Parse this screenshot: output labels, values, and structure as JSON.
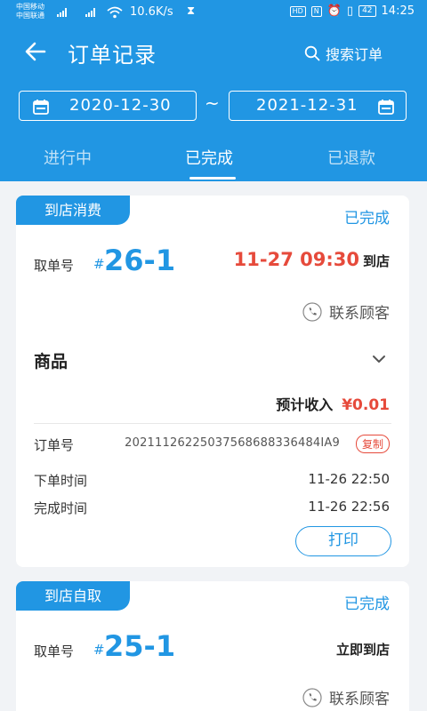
{
  "status_bar": {
    "carrier1": "中国移动",
    "carrier2": "中国联通",
    "net_speed": "10.6K/s",
    "hd": "HD",
    "nfc": "N",
    "battery": "42",
    "time": "14:25"
  },
  "header": {
    "title": "订单记录",
    "search_label": "搜索订单"
  },
  "date_range": {
    "start": "2020-12-30",
    "separator": "~",
    "end": "2021-12-31"
  },
  "tabs": [
    {
      "label": "进行中"
    },
    {
      "label": "已完成"
    },
    {
      "label": "已退款"
    }
  ],
  "orders": [
    {
      "type": "到店消费",
      "status": "已完成",
      "pick_label": "取单号",
      "hash": "#",
      "pick_no": "26-1",
      "arrive_time": "11-27 09:30",
      "arrive_suffix": "到店",
      "contact_label": "联系顾客",
      "goods_label": "商品",
      "income_label": "预计收入",
      "income_amount": "¥0.01",
      "order_no_label": "订单号",
      "order_no": "20211126225037568688336484IA9",
      "copy_label": "复制",
      "created_label": "下单时间",
      "created_time": "11-26 22:50",
      "finished_label": "完成时间",
      "finished_time": "11-26 22:56",
      "print_label": "打印"
    },
    {
      "type": "到店自取",
      "status": "已完成",
      "pick_label": "取单号",
      "hash": "#",
      "pick_no": "25-1",
      "arrive_text": "立即到店",
      "contact_label": "联系顾客"
    }
  ],
  "colors": {
    "primary": "#2196e3",
    "accent_red": "#e64a3b",
    "background": "#f1f3f6"
  }
}
